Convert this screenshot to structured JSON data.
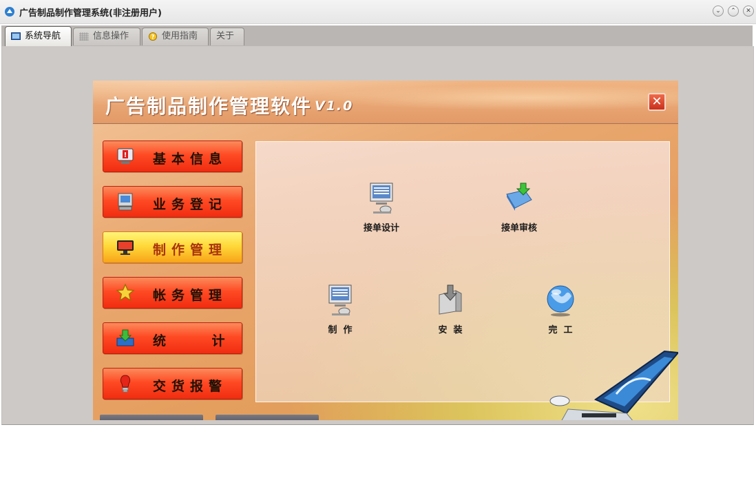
{
  "window": {
    "title": "广告制品制作管理系统(非注册用户)"
  },
  "tabs": [
    {
      "label": "系统导航",
      "icon": "monitor-icon",
      "active": true
    },
    {
      "label": "信息操作",
      "icon": "grid-icon",
      "active": false
    },
    {
      "label": "使用指南",
      "icon": "help-icon",
      "active": false
    },
    {
      "label": "关于",
      "icon": "",
      "active": false
    }
  ],
  "panel": {
    "title": "广告制品制作管理软件",
    "version": "V1.0"
  },
  "menu": [
    {
      "label": "基本信息",
      "icon": "alert-monitor-icon",
      "active": false
    },
    {
      "label": "业务登记",
      "icon": "computer-icon",
      "active": false
    },
    {
      "label": "制作管理",
      "icon": "display-icon",
      "active": true
    },
    {
      "label": "帐务管理",
      "icon": "star-icon",
      "active": false
    },
    {
      "label": "统    计",
      "icon": "download-tray-icon",
      "active": false
    },
    {
      "label": "交货报警",
      "icon": "bulb-alarm-icon",
      "active": false
    }
  ],
  "work_items": [
    {
      "label": "接单设计",
      "icon": "design-computer-icon"
    },
    {
      "label": "接单审核",
      "icon": "review-folder-icon"
    },
    {
      "label": "制  作",
      "icon": "production-computer-icon"
    },
    {
      "label": "安  装",
      "icon": "install-box-icon"
    },
    {
      "label": "完  工",
      "icon": "globe-icon"
    }
  ],
  "colors": {
    "menu_normal": "#ff4a24",
    "menu_active": "#ffd93a",
    "panel_bg": "#e9a870"
  }
}
